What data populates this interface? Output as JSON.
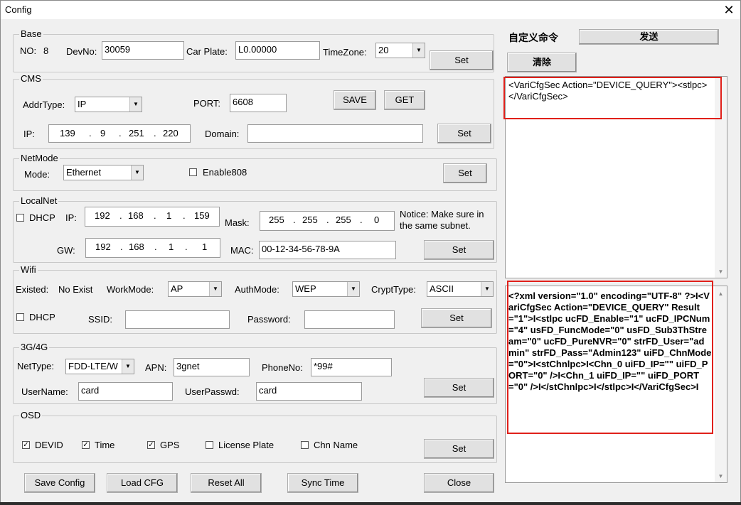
{
  "window": {
    "title": "Config",
    "close_glyph": "✕"
  },
  "base": {
    "legend": "Base",
    "no_label": "NO:",
    "no_value": "8",
    "devno_label": "DevNo:",
    "devno_value": "30059",
    "carplate_label": "Car Plate:",
    "carplate_value": "L0.00000",
    "timezone_label": "TimeZone:",
    "timezone_value": "20",
    "set_label": "Set"
  },
  "cms": {
    "legend": "CMS",
    "addrtype_label": "AddrType:",
    "addrtype_value": "IP",
    "port_label": "PORT:",
    "port_value": "6608",
    "save_label": "SAVE",
    "get_label": "GET",
    "ip_label": "IP:",
    "ip_parts": [
      "139",
      "9",
      "251",
      "220"
    ],
    "domain_label": "Domain:",
    "domain_value": "",
    "set_label": "Set"
  },
  "netmode": {
    "legend": "NetMode",
    "mode_label": "Mode:",
    "mode_value": "Ethernet",
    "enable808_label": "Enable808",
    "enable808_checked": false,
    "set_label": "Set"
  },
  "localnet": {
    "legend": "LocalNet",
    "dhcp_label": "DHCP",
    "dhcp_checked": false,
    "ip_label": "IP:",
    "ip_parts": [
      "192",
      "168",
      "1",
      "159"
    ],
    "mask_label": "Mask:",
    "mask_parts": [
      "255",
      "255",
      "255",
      "0"
    ],
    "notice": "Notice: Make sure in",
    "notice2": "the same subnet.",
    "gw_label": "GW:",
    "gw_parts": [
      "192",
      "168",
      "1",
      "1"
    ],
    "mac_label": "MAC:",
    "mac_value": "00-12-34-56-78-9A",
    "set_label": "Set"
  },
  "wifi": {
    "legend": "Wifi",
    "existed_label": "Existed:",
    "existed_value": "No Exist",
    "workmode_label": "WorkMode:",
    "workmode_value": "AP",
    "authmode_label": "AuthMode:",
    "authmode_value": "WEP",
    "crypttype_label": "CryptType:",
    "crypttype_value": "ASCII",
    "dhcp_label": "DHCP",
    "dhcp_checked": false,
    "ssid_label": "SSID:",
    "ssid_value": "",
    "password_label": "Password:",
    "password_value": "",
    "set_label": "Set"
  },
  "g34": {
    "legend": "3G/4G",
    "nettype_label": "NetType:",
    "nettype_value": "FDD-LTE/W",
    "apn_label": "APN:",
    "apn_value": "3gnet",
    "phoneno_label": "PhoneNo:",
    "phoneno_value": "*99#",
    "username_label": "UserName:",
    "username_value": "card",
    "userpasswd_label": "UserPasswd:",
    "userpasswd_value": "card",
    "set_label": "Set"
  },
  "osd": {
    "legend": "OSD",
    "devid_label": "DEVID",
    "devid_checked": true,
    "time_label": "Time",
    "time_checked": true,
    "gps_label": "GPS",
    "gps_checked": true,
    "license_label": "License Plate",
    "license_checked": false,
    "chnname_label": "Chn Name",
    "chnname_checked": false,
    "set_label": "Set"
  },
  "footer": {
    "save_config": "Save Config",
    "load_cfg": "Load CFG",
    "reset_all": "Reset All",
    "sync_time": "Sync Time",
    "close": "Close"
  },
  "custom": {
    "label": "自定义命令",
    "send_label": "发送",
    "clear_label": "清除",
    "command_text": "<VariCfgSec Action=\"DEVICE_QUERY\"><stlpc></VariCfgSec>",
    "response_text": "<?xml version=\"1.0\" encoding=\"UTF-8\" ?>I<VariCfgSec Action=\"DEVICE_QUERY\" Result=\"1\">I<stlpc ucFD_Enable=\"1\" ucFD_IPCNum=\"4\" usFD_FuncMode=\"0\" usFD_Sub3ThStream=\"0\" ucFD_PureNVR=\"0\" strFD_User=\"admin\" strFD_Pass=\"Admin123\" uiFD_ChnMode=\"0\">I<stChnlpc>I<Chn_0 uiFD_IP=\"\" uiFD_PORT=\"0\" />I<Chn_1 uiFD_IP=\"\" uiFD_PORT=\"0\" />I</stChnlpc>I</stlpc>I</VariCfgSec>I"
  },
  "colors": {
    "highlight": "#e0201a",
    "window_bg": "#f0f0f0"
  }
}
